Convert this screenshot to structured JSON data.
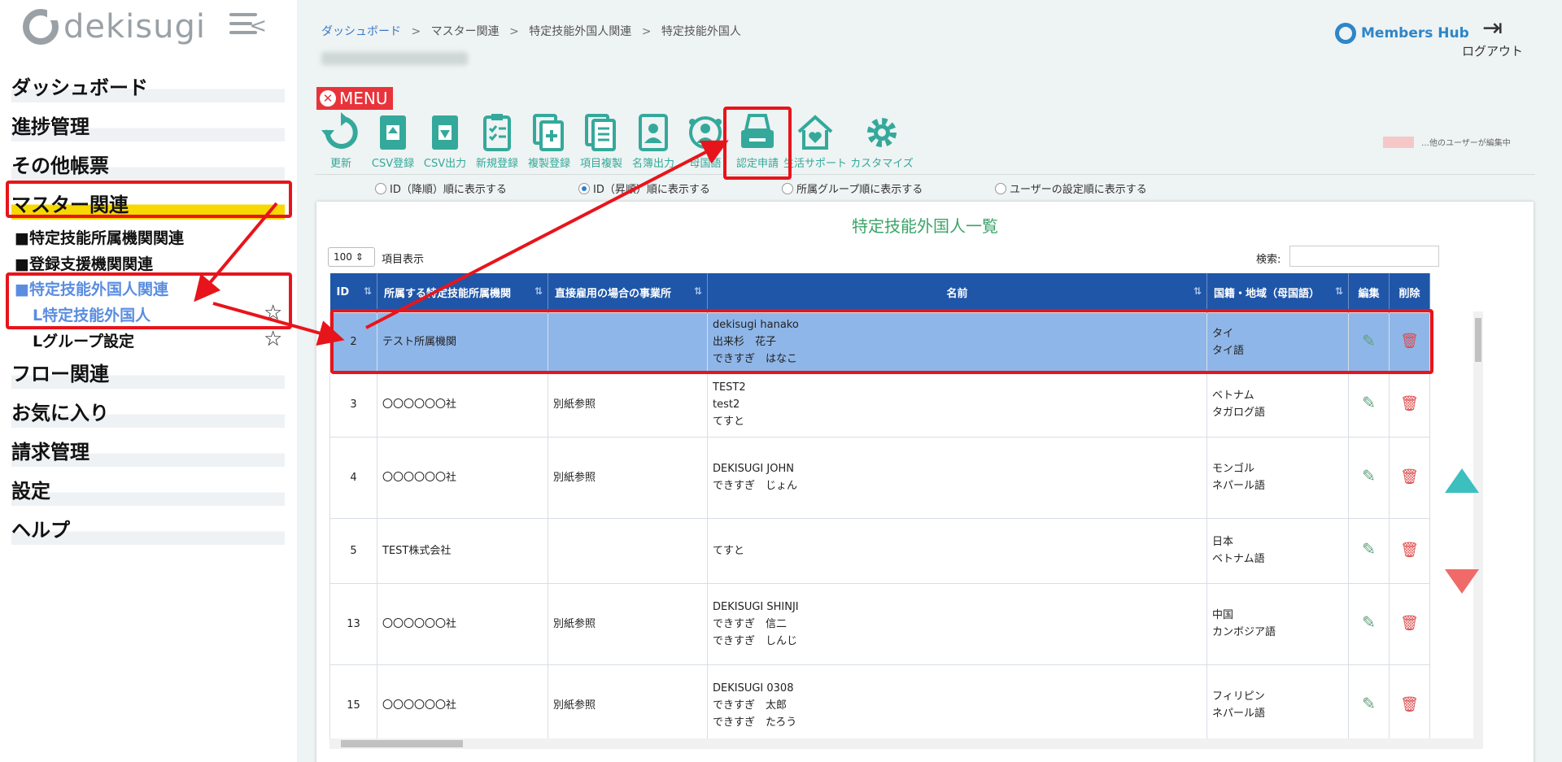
{
  "sidebar": {
    "logo_text": "dekisugi",
    "items": [
      {
        "label": "ダッシュボード"
      },
      {
        "label": "進捗管理"
      },
      {
        "label": "その他帳票"
      },
      {
        "label": "マスター関連"
      },
      {
        "label": "フロー関連"
      },
      {
        "label": "お気に入り"
      },
      {
        "label": "請求管理"
      },
      {
        "label": "設定"
      },
      {
        "label": "ヘルプ"
      }
    ],
    "sub_items": [
      {
        "label": "■特定技能所属機関関連"
      },
      {
        "label": "■登録支援機関関連"
      },
      {
        "label": "■特定技能外国人関連"
      }
    ],
    "subsub_items": [
      {
        "label": "L特定技能外国人"
      },
      {
        "label": "Lグループ設定"
      }
    ],
    "star_icon": "☆"
  },
  "header": {
    "breadcrumb": [
      "ダッシュボード",
      "マスター関連",
      "特定技能外国人関連",
      "特定技能外国人"
    ],
    "breadcrumb_sep": ">",
    "brand_text": "Members Hub",
    "logout_label": "ログアウト",
    "menu_label": "MENU"
  },
  "toolbar": {
    "items": [
      {
        "label": "更新",
        "icon": "refresh-icon"
      },
      {
        "label": "CSV登録",
        "icon": "csv-import-icon"
      },
      {
        "label": "CSV出力",
        "icon": "csv-export-icon"
      },
      {
        "label": "新規登録",
        "icon": "clipboard-icon"
      },
      {
        "label": "複製登録",
        "icon": "copy-add-icon"
      },
      {
        "label": "項目複製",
        "icon": "documents-icon"
      },
      {
        "label": "名簿出力",
        "icon": "id-card-icon"
      },
      {
        "label": "母国語",
        "icon": "globe-person-icon"
      },
      {
        "label": "認定申請",
        "icon": "printer-icon"
      },
      {
        "label": "生活サポート",
        "icon": "house-heart-icon"
      },
      {
        "label": "カスタマイズ",
        "icon": "gear-icon"
      }
    ],
    "legend_text": "…他のユーザーが編集中",
    "legend_color": "#f6c7c7",
    "accent_color": "#34a99b"
  },
  "sort_options": [
    {
      "label": "ID（降順）順に表示する",
      "selected": false
    },
    {
      "label": "ID（昇順）順に表示する",
      "selected": true
    },
    {
      "label": "所属グループ順に表示する",
      "selected": false
    },
    {
      "label": "ユーザーの設定順に表示する",
      "selected": false
    }
  ],
  "list": {
    "title": "特定技能外国人一覧",
    "page_size": "100 ⇕",
    "page_size_label": "項目表示",
    "search_label": "検索:",
    "search_value": "",
    "columns": [
      "ID",
      "所属する特定技能所属機関",
      "直接雇用の場合の事業所",
      "名前",
      "国籍・地域（母国語）",
      "編集",
      "削除"
    ],
    "sort_icon": "⇅",
    "rows": [
      {
        "id": "2",
        "org": "テスト所属機関",
        "office": "",
        "name": [
          "dekisugi hanako",
          "出来杉　花子",
          "できすぎ　はなこ"
        ],
        "nation": [
          "タイ",
          "タイ語"
        ]
      },
      {
        "id": "3",
        "org": "〇〇〇〇〇〇社",
        "office": "別紙参照",
        "name": [
          "TEST2",
          "test2",
          "てすと"
        ],
        "nation": [
          "ベトナム",
          "タガログ語"
        ]
      },
      {
        "id": "4",
        "org": "〇〇〇〇〇〇社",
        "office": "別紙参照",
        "name": [
          "DEKISUGI JOHN",
          "できすぎ　じょん"
        ],
        "nation": [
          "モンゴル",
          "ネパール語"
        ]
      },
      {
        "id": "5",
        "org": "TEST株式会社",
        "office": "",
        "name": [
          "てすと"
        ],
        "nation": [
          "日本",
          "ベトナム語"
        ]
      },
      {
        "id": "13",
        "org": "〇〇〇〇〇〇社",
        "office": "別紙参照",
        "name": [
          "DEKISUGI SHINJI",
          "できすぎ　信二",
          "できすぎ　しんじ"
        ],
        "nation": [
          "中国",
          "カンボジア語"
        ]
      },
      {
        "id": "15",
        "org": "〇〇〇〇〇〇社",
        "office": "別紙参照",
        "name": [
          "DEKISUGI 0308",
          "できすぎ　太郎",
          "できすぎ　たろう"
        ],
        "nation": [
          "フィリピン",
          "ネパール語"
        ]
      }
    ],
    "edit_icon": "wrench-icon",
    "delete_icon": "trash-icon",
    "header_color": "#1f56a8",
    "selected_row_color": "#8fb6e8"
  },
  "annotations": {
    "color": "#e8141b"
  }
}
